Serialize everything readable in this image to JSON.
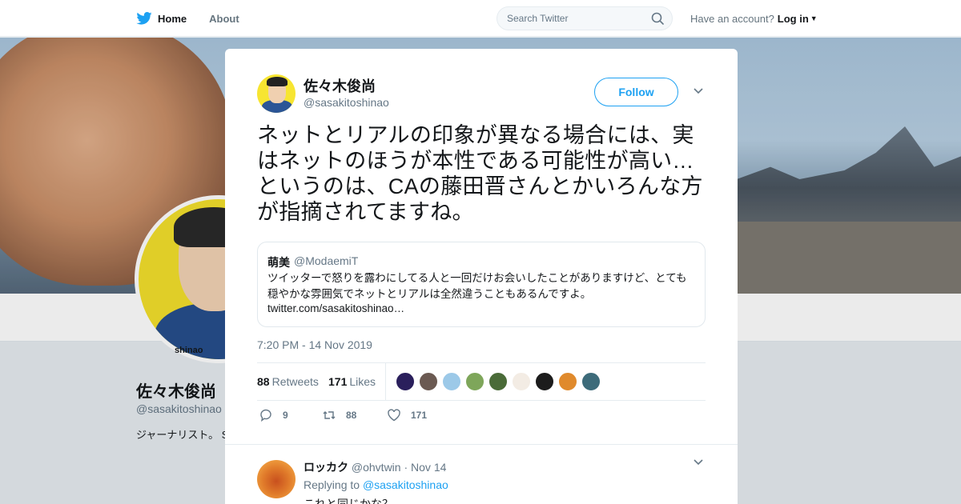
{
  "nav": {
    "home_label": "Home",
    "about_label": "About",
    "search_placeholder": "Search Twitter",
    "account_prompt": "Have an account?",
    "login_label": "Log in",
    "brand_color": "#1da1f2"
  },
  "profile": {
    "name": "佐々木俊尚",
    "handle": "@sasakitoshinao",
    "avatar_caption": "shinao",
    "bio": "ジャーナリスト。 SUSONO運営。N 英語術」ニッポン OK!Cozy up!」Ab 一出演中。総務省"
  },
  "tweet": {
    "author_name": "佐々木俊尚",
    "author_handle": "@sasakitoshinao",
    "follow_label": "Follow",
    "text": "ネットとリアルの印象が異なる場合には、実はネットのほうが本性である可能性が高い…というのは、CAの藤田晋さんとかいろんな方が指摘されてますね。",
    "quote": {
      "name": "萌美",
      "handle": "@ModaemiT",
      "text": "ツイッターで怒りを露わにしてる人と一回だけお会いしたことがありますけど、とても穏やかな雰囲気でネットとリアルは全然違うこともあるんですよ。",
      "link": "twitter.com/sasakitoshinao…"
    },
    "timestamp": "7:20 PM - 14 Nov 2019",
    "retweets_count": "88",
    "retweets_label": "Retweets",
    "likes_count": "171",
    "likes_label": "Likes",
    "likers": [
      {
        "color": "#2a1f5c"
      },
      {
        "color": "#6b5a52"
      },
      {
        "color": "#9cc9e8"
      },
      {
        "color": "#7ea65a"
      },
      {
        "color": "#4a6b38"
      },
      {
        "color": "#f3ece4"
      },
      {
        "color": "#1c1c1c"
      },
      {
        "color": "#e08a2c"
      },
      {
        "color": "#3d6b7a"
      }
    ],
    "actions": {
      "reply_count": "9",
      "retweet_count": "88",
      "like_count": "171"
    }
  },
  "reply": {
    "name": "ロッカク",
    "handle": "@ohvtwin",
    "separator": "·",
    "date": "Nov 14",
    "replying_to_label": "Replying to",
    "replying_to_handle": "@sasakitoshinao",
    "text": "これと同じかな？"
  }
}
